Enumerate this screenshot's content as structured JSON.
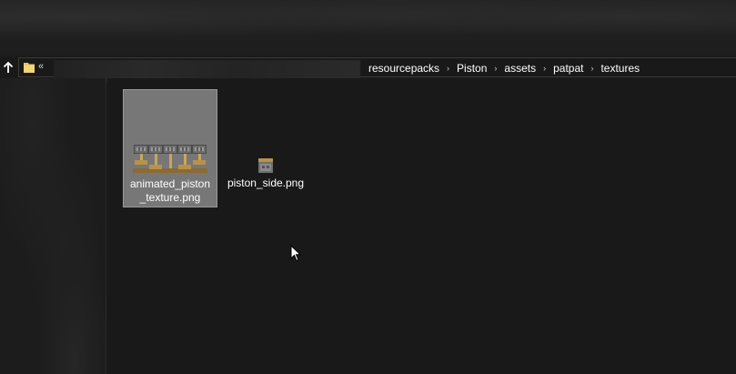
{
  "address_bar": {
    "overflow_chevron": "«",
    "breadcrumbs": [
      "resourcepacks",
      "Piston",
      "assets",
      "patpat",
      "textures"
    ],
    "separator": "›"
  },
  "icons": {
    "up": "up-arrow-icon",
    "folder": "folder-icon"
  },
  "files": [
    {
      "name": "animated_piston_texture.png",
      "label_line1": "animated_piston",
      "label_line2": "_texture.png",
      "selected": true
    },
    {
      "name": "piston_side.png",
      "label_line1": "piston_side.png",
      "selected": false
    }
  ],
  "colors": {
    "background": "#191919",
    "selection": "#777777",
    "folder_yellow": "#e8c25a"
  }
}
